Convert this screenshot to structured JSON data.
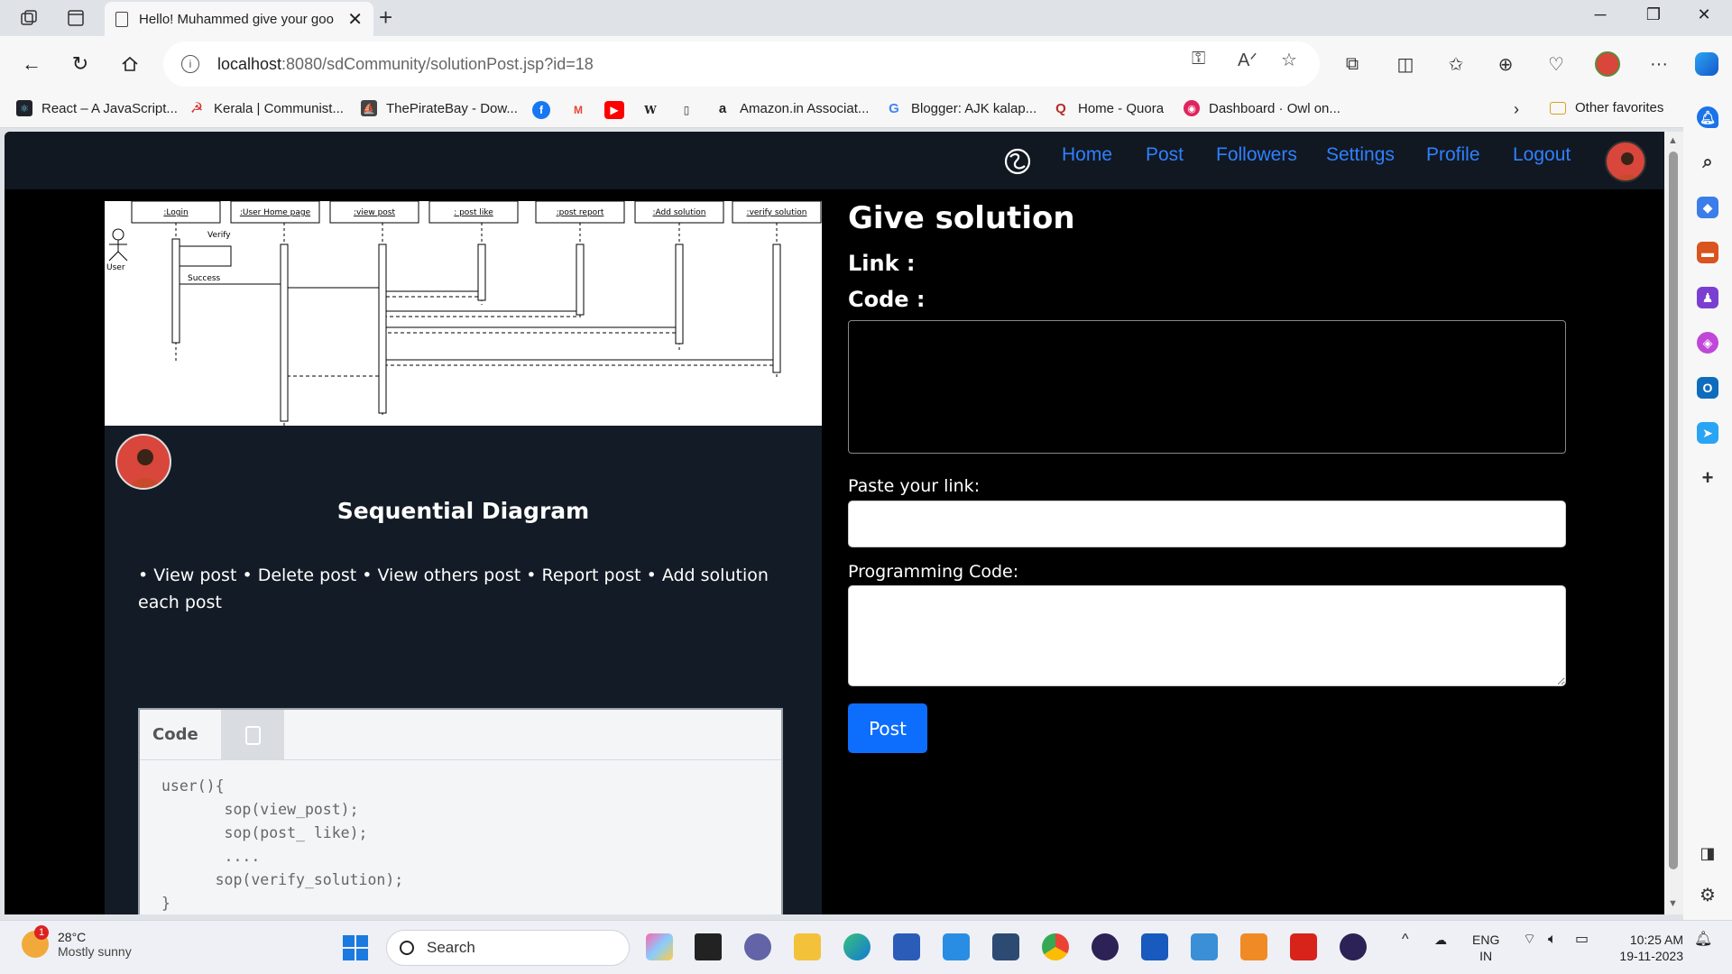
{
  "browser": {
    "tab_title": "Hello! Muhammed give your goo",
    "url_host": "localhost",
    "url_path": ":8080/sdCommunity/solutionPost.jsp?id=18",
    "bookmarks": [
      {
        "label": "React – A JavaScript...",
        "color": "#20232a"
      },
      {
        "label": "Kerala | Communist...",
        "color": "#d32f2f"
      },
      {
        "label": "ThePirateBay - Dow...",
        "color": "#444444"
      },
      {
        "label": "Amazon.in Associat...",
        "color": "#222222"
      },
      {
        "label": "Blogger: AJK kalap...",
        "color": "#4285f4"
      },
      {
        "label": "Home - Quora",
        "color": "#b92b27"
      },
      {
        "label": "Dashboard · Owl on...",
        "color": "#e0245e"
      }
    ],
    "other_favorites": "Other favorites"
  },
  "site": {
    "nav": [
      "Home",
      "Post",
      "Followers",
      "Settings",
      "Profile",
      "Logout"
    ],
    "accent": "#2f80ff"
  },
  "post": {
    "title": "Sequential Diagram",
    "description": "• View post • Delete post • View others post • Report post • Add solution each post",
    "code_label": "Code",
    "code": "user(){\n       sop(view_post);\n       sop(post_ like);\n       ....\n      sop(verify_solution);\n}",
    "diagram": {
      "lifelines": [
        ":Login",
        ":User Home page",
        ":view post",
        ": post like",
        ":post report",
        ":Add solution",
        ":verify solution"
      ],
      "actor": "User",
      "messages": [
        "Verify",
        "Success"
      ]
    }
  },
  "form": {
    "heading": "Give solution",
    "link_label": "Link :",
    "code_label": "Code :",
    "paste_label": "Paste your link:",
    "programming_label": "Programming Code:",
    "link_value": "",
    "code_value": "",
    "submit": "Post"
  },
  "taskbar": {
    "temp": "28°C",
    "weather": "Mostly sunny",
    "weather_badge": "1",
    "search": "Search",
    "lang1": "ENG",
    "lang2": "IN",
    "time": "10:25 AM",
    "date": "19-11-2023"
  }
}
